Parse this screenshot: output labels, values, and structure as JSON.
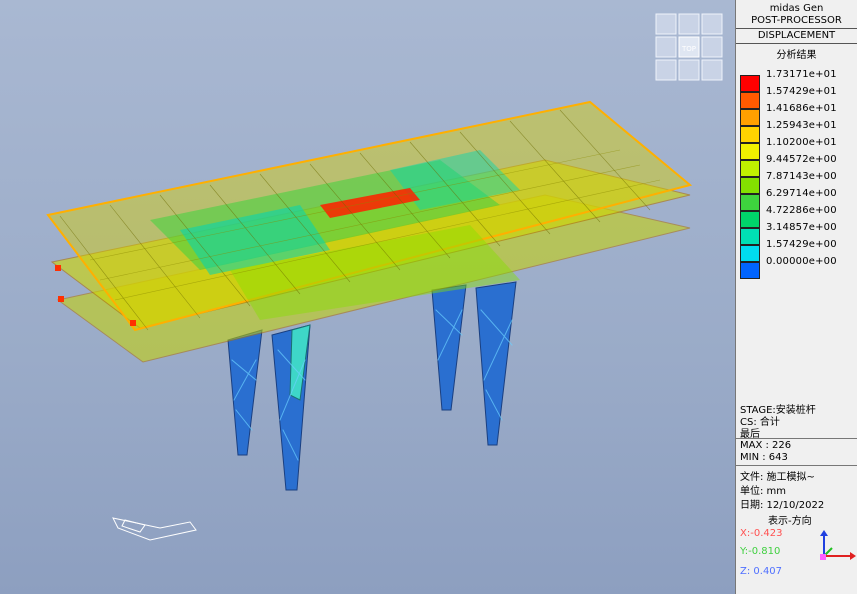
{
  "app": {
    "title_line1": "midas Gen",
    "title_line2": "POST-PROCESSOR",
    "result_type": "DISPLACEMENT",
    "section_title": "分析结果"
  },
  "viewcube": {
    "top_label": "TOP"
  },
  "legend": {
    "items": [
      {
        "label": "1.73171e+01",
        "color": "#ff0000"
      },
      {
        "label": "1.57429e+01",
        "color": "#ff5a00"
      },
      {
        "label": "1.41686e+01",
        "color": "#ffa000"
      },
      {
        "label": "1.25943e+01",
        "color": "#ffd200"
      },
      {
        "label": "1.10200e+01",
        "color": "#f0f000"
      },
      {
        "label": "9.44572e+00",
        "color": "#c0f000"
      },
      {
        "label": "7.87143e+00",
        "color": "#84e000"
      },
      {
        "label": "6.29714e+00",
        "color": "#3ed43e"
      },
      {
        "label": "4.72286e+00",
        "color": "#00d46a"
      },
      {
        "label": "3.14857e+00",
        "color": "#00e0b4"
      },
      {
        "label": "1.57429e+00",
        "color": "#00dcf0"
      },
      {
        "label": "0.00000e+00",
        "color": "#0064ff"
      }
    ]
  },
  "info": {
    "stage": "STAGE:安装桩杆",
    "cs": "CS: 合计",
    "last": "最后",
    "max": "MAX : 226",
    "min": "MIN : 643",
    "file": "文件: 施工模拟~",
    "unit": "单位: mm",
    "date": "日期:  12/10/2022",
    "view_dir": "表示-方向",
    "x": "X:-0.423",
    "y": "Y:-0.810",
    "z": "Z: 0.407"
  }
}
